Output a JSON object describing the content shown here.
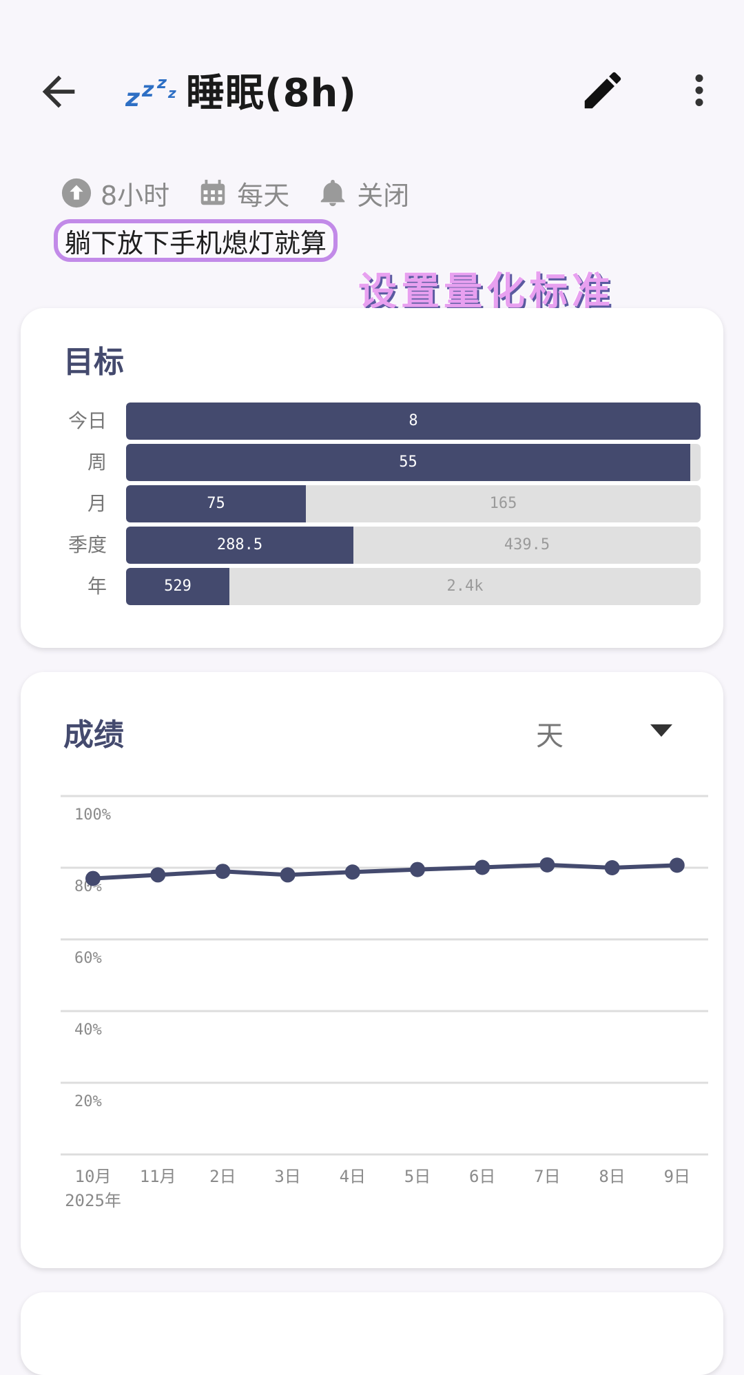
{
  "header": {
    "title": "睡眠(8h)",
    "back_icon": "arrow-back-icon",
    "sleep_icon": "zzz-icon",
    "edit_icon": "pencil-icon",
    "more_icon": "more-vert-icon"
  },
  "meta": {
    "target": "8小时",
    "frequency": "每天",
    "reminder": "关闭"
  },
  "description": "躺下放下手机熄灯就算",
  "overlay_caption": "设置量化标准",
  "goal_card": {
    "title": "目标",
    "rows": [
      {
        "label": "今日",
        "done": "8",
        "remaining": "",
        "fraction": 1.0
      },
      {
        "label": "周",
        "done": "55",
        "remaining": "",
        "fraction": 0.982
      },
      {
        "label": "月",
        "done": "75",
        "remaining": "165",
        "fraction": 0.3125
      },
      {
        "label": "季度",
        "done": "288.5",
        "remaining": "439.5",
        "fraction": 0.396
      },
      {
        "label": "年",
        "done": "529",
        "remaining": "2.4k",
        "fraction": 0.18
      }
    ]
  },
  "score_card": {
    "title": "成绩",
    "period": "天",
    "year_label": "2025年"
  },
  "chart_data": {
    "type": "line",
    "categories": [
      "10月",
      "11月",
      "2日",
      "3日",
      "4日",
      "5日",
      "6日",
      "7日",
      "8日",
      "9日"
    ],
    "series": [
      {
        "values": [
          77,
          78,
          79,
          78,
          78.8,
          79.5,
          80.1,
          80.8,
          80,
          80.7
        ]
      }
    ],
    "ylim": [
      0,
      100
    ],
    "yticks": [
      "100%",
      "80%",
      "60%",
      "40%",
      "20%"
    ],
    "grid": true,
    "color": "#444a6e"
  }
}
